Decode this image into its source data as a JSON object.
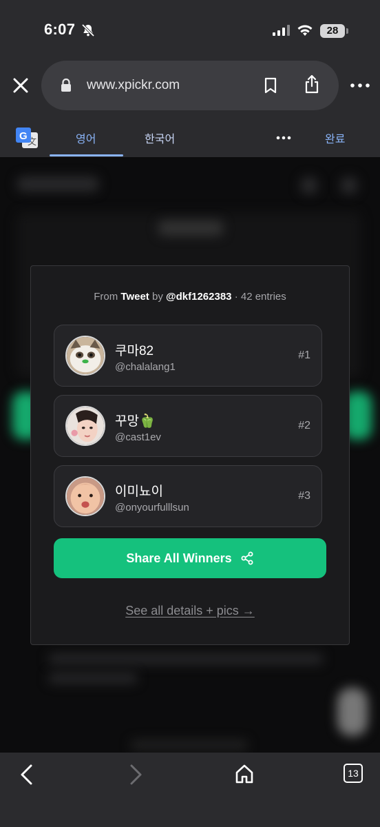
{
  "status_bar": {
    "time": "6:07",
    "battery": "28"
  },
  "browser": {
    "url": "www.xpickr.com",
    "tab_count": "13"
  },
  "translate_bar": {
    "tab_source": "영어",
    "tab_target": "한국어",
    "done": "완료"
  },
  "card": {
    "from_prefix": "From",
    "source": "Tweet",
    "by": "by",
    "author": "@dkf1262383",
    "entries": "· 42 entries",
    "winners": [
      {
        "name": "쿠마82",
        "handle": "@chalalang1",
        "rank": "#1"
      },
      {
        "name": "꾸망🫑",
        "handle": "@cast1ev",
        "rank": "#2"
      },
      {
        "name": "이미뇨이",
        "handle": "@onyourfulllsun",
        "rank": "#3"
      }
    ],
    "share_label": "Share All Winners",
    "details_link": "See all details + pics →"
  },
  "colors": {
    "accent_green": "#15c17d",
    "link_blue": "#8ab4f8",
    "card_bg": "#1b1b1d"
  }
}
